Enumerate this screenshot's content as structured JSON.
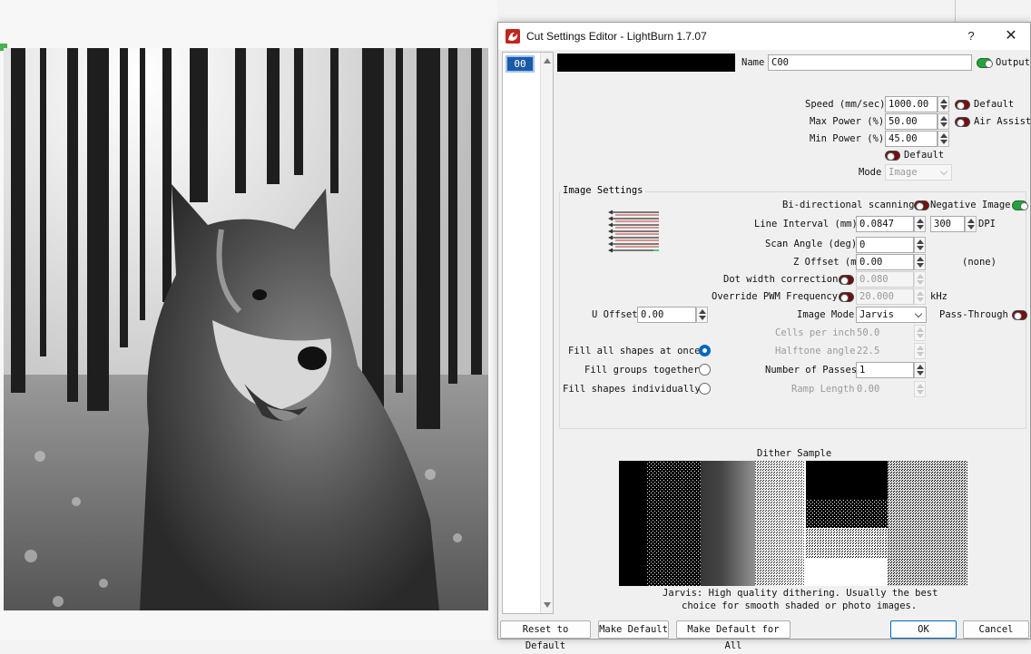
{
  "dialog": {
    "title": "Cut Settings Editor - LightBurn 1.7.07",
    "help_label": "?",
    "close_label": "✕"
  },
  "layer": {
    "item_label": "00",
    "color": "#000000"
  },
  "name": {
    "label": "Name",
    "value": "C00"
  },
  "output": {
    "label": "Output",
    "on": true
  },
  "speed": {
    "label": "Speed (mm/sec)",
    "value": "1000.00"
  },
  "max_power": {
    "label": "Max Power (%)",
    "value": "50.00"
  },
  "min_power": {
    "label": "Min Power (%)",
    "value": "45.00"
  },
  "default_toggle": {
    "label": "Default"
  },
  "air_assist": {
    "label": "Air Assist"
  },
  "default_toggle_2": {
    "label": "Default"
  },
  "mode": {
    "label": "Mode",
    "value": "Image"
  },
  "image_settings": {
    "group_title": "Image Settings",
    "bidirectional": {
      "label": "Bi-directional scanning"
    },
    "negative": {
      "label": "Negative Image",
      "on": true
    },
    "line_interval": {
      "label": "Line Interval (mm)",
      "value": "0.0847",
      "dpi_value": "300",
      "dpi_label": "DPI"
    },
    "scan_angle": {
      "label": "Scan Angle (deg)",
      "value": "0"
    },
    "z_offset": {
      "label": "Z Offset (mm)",
      "value": "0.00",
      "extra": "(none)"
    },
    "dot_width": {
      "label": "Dot width correction",
      "value": "0.080"
    },
    "pwm": {
      "label": "Override PWM Frequency",
      "value": "20.000",
      "unit": "kHz"
    },
    "u_offset": {
      "label": "U Offset",
      "value": "0.00"
    },
    "image_mode": {
      "label": "Image Mode",
      "value": "Jarvis"
    },
    "pass_through": {
      "label": "Pass-Through"
    },
    "cells_per_inch": {
      "label": "Cells per inch",
      "value": "50.0"
    },
    "halftone_angle": {
      "label": "Halftone angle",
      "value": "22.5"
    },
    "passes": {
      "label": "Number of Passes",
      "value": "1"
    },
    "ramp_length": {
      "label": "Ramp Length",
      "value": "0.00"
    },
    "fill_options": [
      {
        "label": "Fill all shapes at once",
        "checked": true
      },
      {
        "label": "Fill groups together",
        "checked": false
      },
      {
        "label": "Fill shapes individually",
        "checked": false
      }
    ]
  },
  "dither": {
    "title": "Dither Sample",
    "desc_line1": "Jarvis: High quality dithering. Usually the best",
    "desc_line2": "choice for smooth shaded or photo images."
  },
  "buttons": {
    "reset": "Reset to Default",
    "make_default": "Make Default",
    "make_default_all": "Make Default for All",
    "ok": "OK",
    "cancel": "Cancel"
  }
}
